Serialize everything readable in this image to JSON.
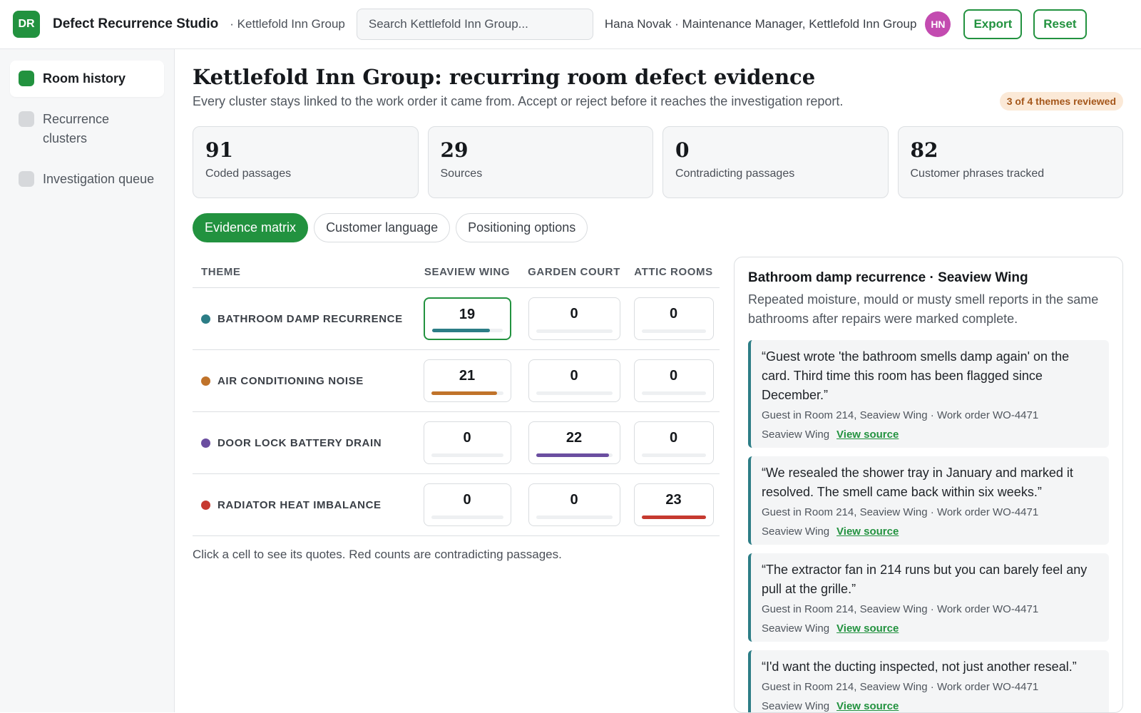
{
  "app": {
    "logo_initials": "DR",
    "title": "Defect Recurrence Studio",
    "org_crumb": "· Kettlefold Inn Group",
    "search_placeholder": "Search Kettlefold Inn Group...",
    "user_line": "Hana Novak · Maintenance Manager, Kettlefold Inn Group",
    "avatar_initials": "HN",
    "export_label": "Export",
    "reset_label": "Reset"
  },
  "sidebar": {
    "items": [
      {
        "label": "Room history",
        "active": true
      },
      {
        "label": "Recurrence clusters",
        "active": false
      },
      {
        "label": "Investigation queue",
        "active": false
      }
    ]
  },
  "page": {
    "title": "Kettlefold Inn Group: recurring room defect evidence",
    "subtitle": "Every cluster stays linked to the work order it came from. Accept or reject before it reaches the investigation report.",
    "review_badge": "3 of 4 themes reviewed"
  },
  "stats": [
    {
      "value": "91",
      "label": "Coded passages"
    },
    {
      "value": "29",
      "label": "Sources"
    },
    {
      "value": "0",
      "label": "Contradicting passages"
    },
    {
      "value": "82",
      "label": "Customer phrases tracked"
    }
  ],
  "tabs": [
    {
      "label": "Evidence matrix",
      "active": true
    },
    {
      "label": "Customer language",
      "active": false
    },
    {
      "label": "Positioning options",
      "active": false
    }
  ],
  "matrix": {
    "headers": [
      "THEME",
      "SEAVIEW WING",
      "GARDEN COURT",
      "ATTIC ROOMS"
    ],
    "max_value": 23,
    "rows": [
      {
        "theme": "BATHROOM DAMP RECURRENCE",
        "color": "#2c7d86",
        "values": [
          "19",
          "0",
          "0"
        ],
        "selected_col": 0
      },
      {
        "theme": "AIR CONDITIONING NOISE",
        "color": "#c0732a",
        "values": [
          "21",
          "0",
          "0"
        ],
        "selected_col": -1
      },
      {
        "theme": "DOOR LOCK BATTERY DRAIN",
        "color": "#6b4ea0",
        "values": [
          "0",
          "22",
          "0"
        ],
        "selected_col": -1
      },
      {
        "theme": "RADIATOR HEAT IMBALANCE",
        "color": "#c6392f",
        "values": [
          "0",
          "0",
          "23"
        ],
        "selected_col": -1
      }
    ],
    "hint": "Click a cell to see its quotes. Red counts are contradicting passages."
  },
  "detail": {
    "title": "Bathroom damp recurrence · Seaview Wing",
    "description": "Repeated moisture, mould or musty smell reports in the same bathrooms after repairs were marked complete.",
    "quotes": [
      {
        "text": "“Guest wrote 'the bathroom smells damp again' on the card. Third time this room has been flagged since December.”",
        "source": "Guest in Room 214, Seaview Wing · Work order WO-4471",
        "location": "Seaview Wing",
        "link": "View source"
      },
      {
        "text": "“We resealed the shower tray in January and marked it resolved. The smell came back within six weeks.”",
        "source": "Guest in Room 214, Seaview Wing · Work order WO-4471",
        "location": "Seaview Wing",
        "link": "View source"
      },
      {
        "text": "“The extractor fan in 214 runs but you can barely feel any pull at the grille.”",
        "source": "Guest in Room 214, Seaview Wing · Work order WO-4471",
        "location": "Seaview Wing",
        "link": "View source"
      },
      {
        "text": "“I'd want the ducting inspected, not just another reseal.”",
        "source": "Guest in Room 214, Seaview Wing · Work order WO-4471",
        "location": "Seaview Wing",
        "link": "View source"
      }
    ]
  }
}
